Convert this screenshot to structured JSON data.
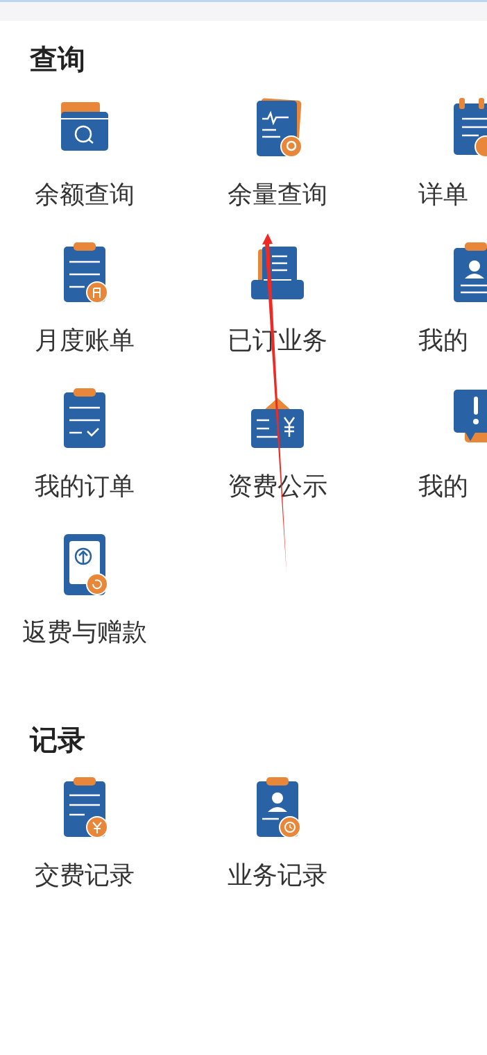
{
  "sections": [
    {
      "title": "查询",
      "items": [
        {
          "label": "余额查询"
        },
        {
          "label": "余量查询"
        },
        {
          "label": "详单"
        },
        {
          "label": "月度账单"
        },
        {
          "label": "已订业务"
        },
        {
          "label": "我的"
        },
        {
          "label": "我的订单"
        },
        {
          "label": "资费公示"
        },
        {
          "label": "我的"
        },
        {
          "label": "返费与赠款"
        }
      ]
    },
    {
      "title": "记录",
      "items": [
        {
          "label": "交费记录"
        },
        {
          "label": "业务记录"
        }
      ]
    }
  ]
}
